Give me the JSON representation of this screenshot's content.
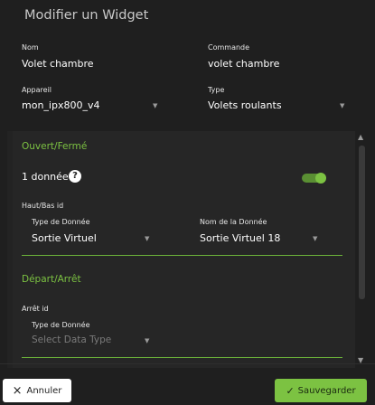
{
  "dialog": {
    "title": "Modifier un Widget"
  },
  "fields": {
    "nom_label": "Nom",
    "nom_value": "Volet chambre",
    "commande_label": "Commande",
    "commande_value": "volet chambre",
    "appareil_label": "Appareil",
    "appareil_value": "mon_ipx800_v4",
    "type_label": "Type",
    "type_value": "Volets roulants"
  },
  "section_open_close": {
    "title": "Ouvert/Fermé",
    "data_count": "1 donnée",
    "help_icon": "?",
    "toggle_on": true,
    "id_label": "Haut/Bas id",
    "data_type_label": "Type de Donnée",
    "data_type_value": "Sortie Virtuel",
    "data_name_label": "Nom de la Donnée",
    "data_name_value": "Sortie Virtuel 18"
  },
  "section_start_stop": {
    "title": "Départ/Arrêt",
    "id_label": "Arrêt id",
    "data_type_label": "Type de Donnée",
    "data_type_placeholder": "Select Data Type"
  },
  "footer": {
    "cancel_icon": "×",
    "cancel_label": "Annuler",
    "save_icon": "✓",
    "save_label": "Sauvegarder"
  },
  "colors": {
    "accent": "#7cc242",
    "background": "#1f1f1f",
    "panel": "#262626"
  }
}
